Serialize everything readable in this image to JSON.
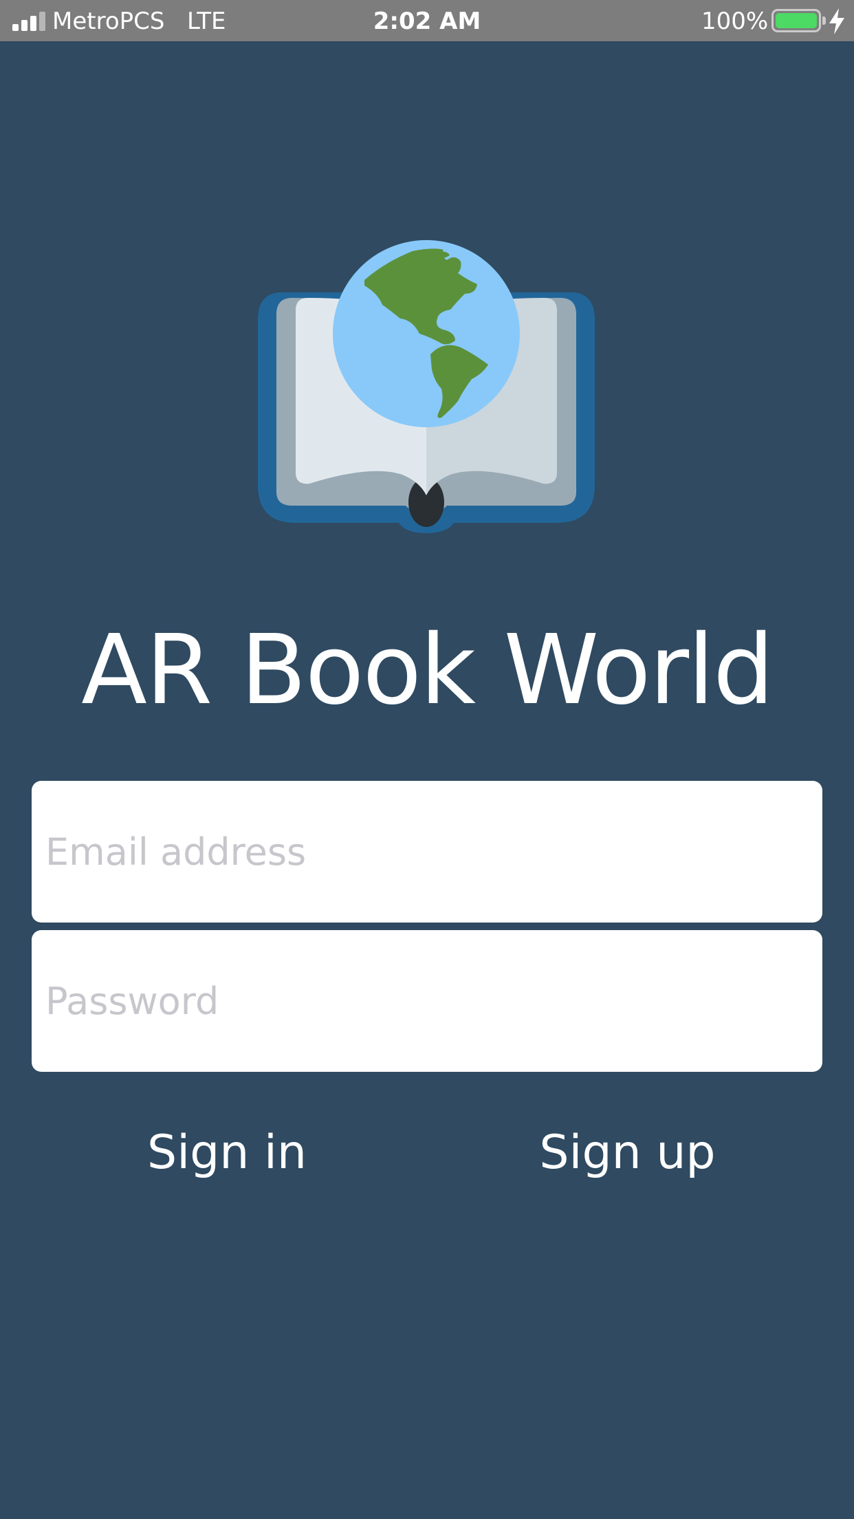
{
  "status_bar": {
    "carrier": "MetroPCS",
    "network": "LTE",
    "time": "2:02 AM",
    "battery_percent": "100%",
    "battery_level": 1.0,
    "charging": true
  },
  "app": {
    "title": "AR Book World",
    "logo_icon": "book-globe-icon"
  },
  "form": {
    "email_placeholder": "Email address",
    "password_placeholder": "Password",
    "sign_in_label": "Sign in",
    "sign_up_label": "Sign up"
  },
  "colors": {
    "background": "#2f4a61",
    "status_bar": "#7d7d7d",
    "field_background": "#ffffff",
    "placeholder": "#c6c6cc",
    "book_cover": "#226699",
    "globe_ocean": "#88c9f9",
    "globe_land": "#5c913b"
  }
}
